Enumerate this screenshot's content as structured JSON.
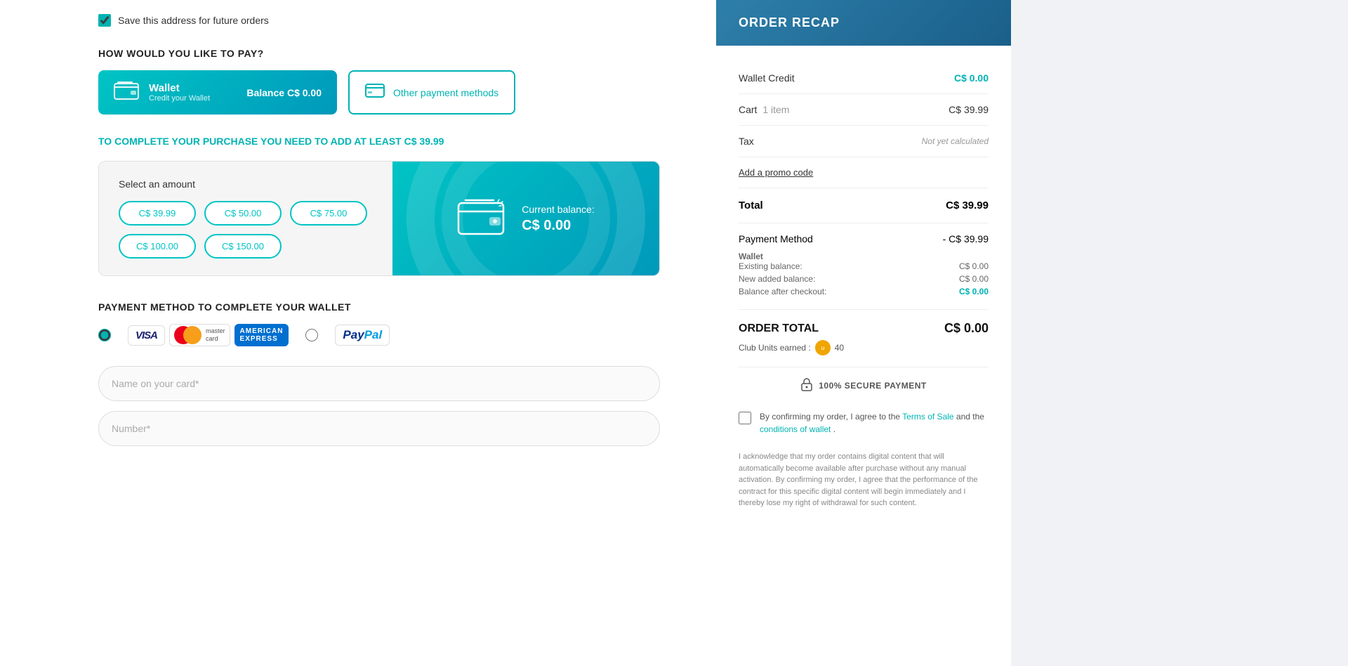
{
  "page": {
    "save_address": {
      "label": "Save this address for future orders",
      "checked": true
    },
    "payment_section": {
      "title": "HOW WOULD YOU LIKE TO PAY?",
      "wallet_button": {
        "name": "Wallet",
        "subtitle": "Credit your Wallet",
        "balance_label": "Balance",
        "balance_value": "C$ 0.00"
      },
      "other_button": {
        "label": "Other payment methods"
      }
    },
    "complete_notice": {
      "prefix": "TO COMPLETE YOUR PURCHASE YOU NEED TO",
      "amount": "ADD AT LEAST C$ 39.99"
    },
    "amount_selector": {
      "label": "Select an amount",
      "amounts": [
        "C$ 39.99",
        "C$ 50.00",
        "C$ 75.00",
        "C$ 100.00",
        "C$ 150.00"
      ]
    },
    "wallet_display": {
      "label": "Current balance:",
      "value": "C$ 0.00"
    },
    "payment_method_section": {
      "title": "PAYMENT METHOD TO COMPLETE YOUR WALLET"
    },
    "form": {
      "name_placeholder": "Name on your card*",
      "number_placeholder": "Number*"
    }
  },
  "sidebar": {
    "header": "ORDER RECAP",
    "wallet_credit_label": "Wallet Credit",
    "wallet_credit_value": "C$ 0.00",
    "cart_label": "Cart",
    "cart_sub": "1 item",
    "cart_value": "C$ 39.99",
    "tax_label": "Tax",
    "tax_value": "Not yet calculated",
    "promo_link": "Add a promo code",
    "total_label": "Total",
    "total_value": "C$ 39.99",
    "payment_method_label": "Payment Method",
    "payment_method_value": "- C$ 39.99",
    "wallet_label": "Wallet",
    "existing_balance_label": "Existing balance:",
    "existing_balance_value": "C$ 0.00",
    "new_added_label": "New added balance:",
    "new_added_value": "C$ 0.00",
    "after_checkout_label": "Balance after checkout:",
    "after_checkout_value": "C$ 0.00",
    "order_total_label": "ORDER TOTAL",
    "order_total_value": "C$ 0.00",
    "club_units_label": "Club Units earned :",
    "club_units_value": "40",
    "secure_label": "100% SECURE PAYMENT",
    "terms_label": "By confirming my order, I agree to the",
    "terms_link1": "Terms of Sale",
    "terms_and": "and the",
    "terms_link2": "conditions of wallet",
    "terms_end": ".",
    "disclaimer": "I acknowledge that my order contains digital content that will automatically become available after purchase without any manual activation. By confirming my order, I agree that the performance of the contract for this specific digital content will begin immediately and I thereby lose my right of withdrawal for such content."
  }
}
